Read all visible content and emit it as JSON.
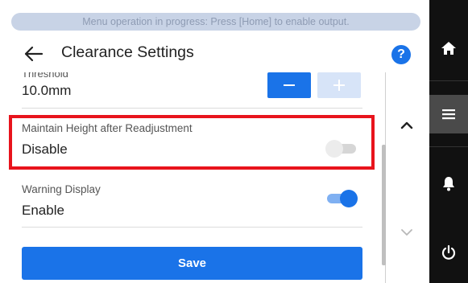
{
  "banner": {
    "text": "Menu operation in progress: Press [Home] to enable output."
  },
  "header": {
    "title": "Clearance Settings",
    "help_label": "?"
  },
  "threshold": {
    "label": "Threshold",
    "value": "10.0mm"
  },
  "settings": [
    {
      "label": "Maintain Height after Readjustment",
      "value": "Disable",
      "enabled": false,
      "highlighted": true
    },
    {
      "label": "Warning Display",
      "value": "Enable",
      "enabled": true,
      "highlighted": false
    }
  ],
  "save_label": "Save",
  "right_bar": [
    "home-icon",
    "menu-icon",
    "bell-icon",
    "power-icon"
  ],
  "colors": {
    "accent": "#1a73e8",
    "highlight": "#e8141c",
    "sidebar": "#111111"
  }
}
